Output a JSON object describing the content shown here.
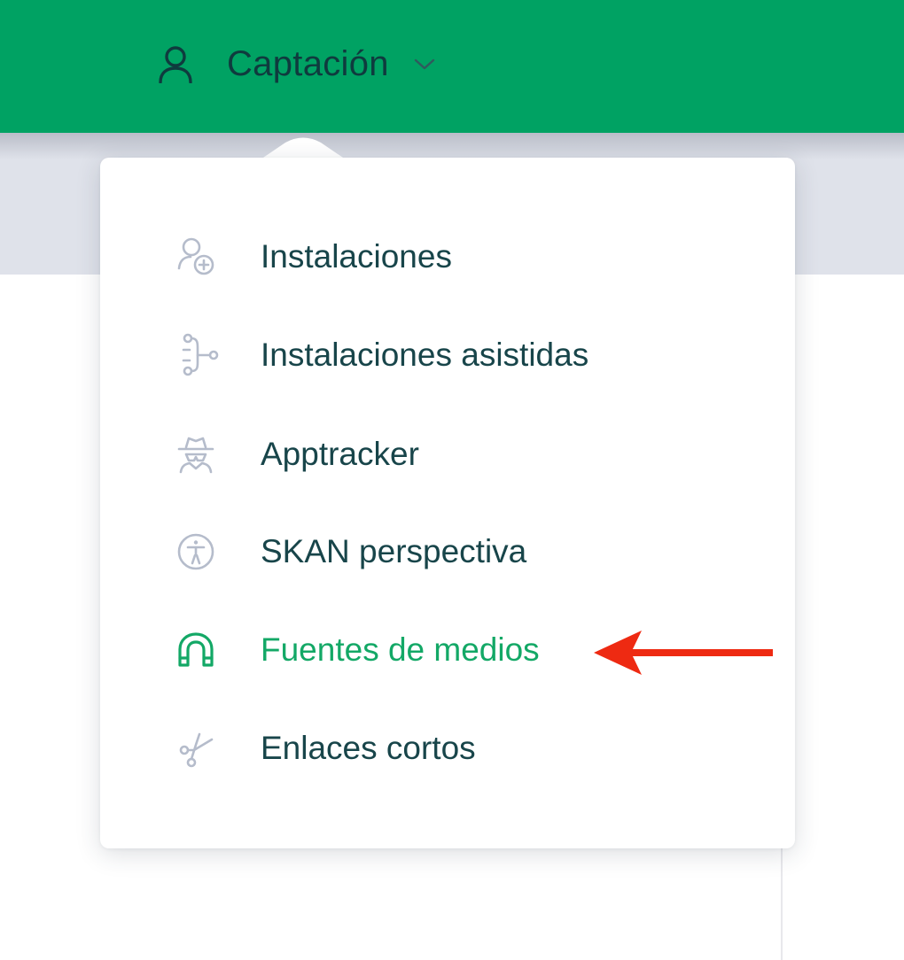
{
  "header": {
    "menu_label": "Captación",
    "icon": "user-icon",
    "chevron_icon": "chevron-down-icon",
    "background_color": "#00a263"
  },
  "dropdown": {
    "items": [
      {
        "label": "Instalaciones",
        "icon": "user-plus-icon",
        "active": false
      },
      {
        "label": "Instalaciones asistidas",
        "icon": "branch-flow-icon",
        "active": false
      },
      {
        "label": "Apptracker",
        "icon": "spy-icon",
        "active": false
      },
      {
        "label": "SKAN perspectiva",
        "icon": "accessibility-icon",
        "active": false
      },
      {
        "label": "Fuentes de medios",
        "icon": "magnet-icon",
        "active": true
      },
      {
        "label": "Enlaces cortos",
        "icon": "scissors-icon",
        "active": false
      }
    ]
  },
  "annotation": {
    "type": "red-arrow-pointing-left",
    "target": "Fuentes de medios",
    "color": "#ee2a12"
  },
  "colors": {
    "text_default": "#18454a",
    "text_active": "#13a866",
    "icon_default": "#b5bccb",
    "subbar": "#dfe2ea"
  }
}
